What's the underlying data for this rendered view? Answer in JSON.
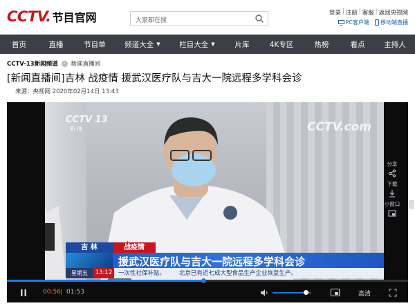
{
  "header": {
    "logo_cctv": "CCTV.",
    "logo_site": "节目官网",
    "search_placeholder": "大家都在搜",
    "links": [
      "登录",
      "注册",
      "客服",
      "返回央视网"
    ],
    "apps": [
      "PC客户端",
      "移动端直播"
    ]
  },
  "nav": {
    "items": [
      {
        "label": "首页",
        "dropdown": false
      },
      {
        "label": "直播",
        "dropdown": false
      },
      {
        "label": "节目单",
        "dropdown": false
      },
      {
        "label": "频道大全",
        "dropdown": true
      },
      {
        "label": "栏目大全",
        "dropdown": true
      },
      {
        "label": "片库",
        "dropdown": false
      },
      {
        "label": "4K专区",
        "dropdown": false
      },
      {
        "label": "热榜",
        "dropdown": false
      },
      {
        "label": "看点",
        "dropdown": false
      },
      {
        "label": "主持人",
        "dropdown": false
      }
    ]
  },
  "breadcrumb": {
    "channel": "CCTV-13新闻频道",
    "sub": "新闻直播间"
  },
  "article": {
    "title": "[新闻直播间]吉林 战疫情 援武汉医疗队与吉大一院远程多学科会诊",
    "meta": "来源：央视网 2020年02月14日 13:43"
  },
  "video": {
    "watermark_left": "CCTV 13",
    "watermark_left_sub": "新 闻",
    "watermark_right": "CCTV.com",
    "tag_location": "吉 林",
    "tag_topic": "战疫情",
    "headline": "援武汉医疗队与吉大一院远程多学科会诊",
    "weekday": "星期五",
    "clock": "13:12",
    "ticker_left": "一次性社保补贴。",
    "ticker_right": "北京已有近七成大型食品生产企业恢复生产。",
    "side_panel": [
      "分享",
      "下载",
      "小窗口"
    ]
  },
  "player": {
    "current_time": "00:56",
    "separator": "|",
    "duration": "01:53",
    "quality": "高清",
    "progress": 0.49,
    "volume": 0.85
  },
  "colors": {
    "brand_red": "#c8161d",
    "nav_bg": "#3c3f46",
    "accent_blue": "#1f7ae0",
    "time_orange": "#f07c2a"
  }
}
